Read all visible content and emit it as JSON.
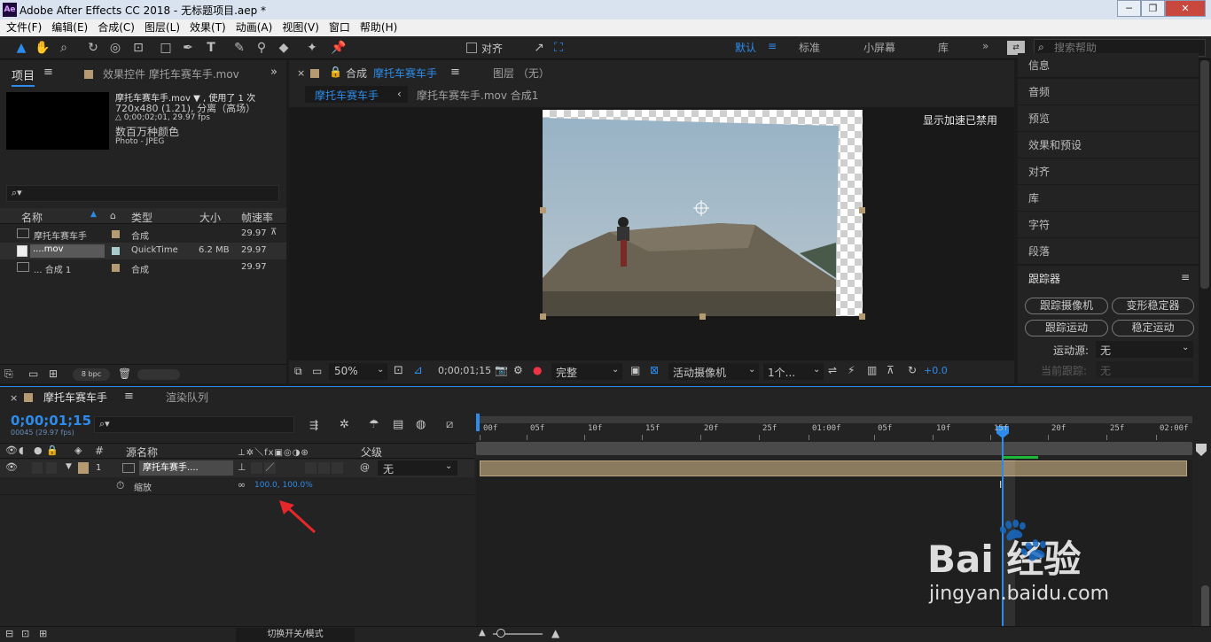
{
  "titlebar": {
    "app_icon": "Ae",
    "title": "Adobe After Effects CC 2018 - 无标题项目.aep *",
    "minimize": "─",
    "restore": "❐",
    "close": "✕"
  },
  "menu": [
    "文件(F)",
    "编辑(E)",
    "合成(C)",
    "图层(L)",
    "效果(T)",
    "动画(A)",
    "视图(V)",
    "窗口",
    "帮助(H)"
  ],
  "toolbar": {
    "snap_label": "对齐",
    "workspaces": [
      "默认",
      "标准",
      "小屏幕",
      "库"
    ],
    "search_placeholder": "搜索帮助"
  },
  "project": {
    "tab": "项目",
    "effects_tab": "效果控件 摩托车赛车手.mov",
    "selected_name": "摩托车赛车手.mov ▼ , 使用了 1 次",
    "info1": "720x480 (1.21), 分离（高场）",
    "info2": "△ 0;00;02;01, 29.97 fps",
    "info3": "数百万种颜色",
    "info4": "Photo - JPEG",
    "columns": [
      "名称",
      "类型",
      "大小",
      "帧速率"
    ],
    "rows": [
      {
        "name": "摩托车赛车手",
        "type": "合成",
        "size": "",
        "fps": "29.97",
        "color": "#b59a72"
      },
      {
        "name": "....mov",
        "type": "QuickTime",
        "size": "6.2 MB",
        "fps": "29.97",
        "color": "#a8cbcc"
      },
      {
        "name": "... 合成 1",
        "type": "合成",
        "size": "",
        "fps": "29.97",
        "color": "#b59a72"
      }
    ],
    "bpc": "8 bpc"
  },
  "viewer": {
    "comp_tab_prefix": "合成",
    "comp_name": "摩托车赛车手",
    "layer_tab": "图层 （无）",
    "nav_comp": "摩托车赛车手",
    "nav_path": "摩托车赛车手.mov 合成1",
    "accel_msg": "显示加速已禁用",
    "zoom": "50%",
    "timecode": "0;00;01;15",
    "quality": "完整",
    "camera": "活动摄像机",
    "views": "1个...",
    "exposure": "+0.0"
  },
  "right_panel": {
    "items": [
      "信息",
      "音频",
      "预览",
      "效果和预设",
      "对齐",
      "库",
      "字符",
      "段落"
    ],
    "tracker": {
      "title": "跟踪器",
      "buttons": [
        "跟踪摄像机",
        "变形稳定器",
        "跟踪运动",
        "稳定运动"
      ],
      "source_label": "运动源:",
      "source_value": "无",
      "current_label": "当前跟踪:",
      "current_value": "无"
    }
  },
  "timeline": {
    "tab": "摩托车赛车手",
    "render_tab": "渲染队列",
    "timecode": "0;00;01;15",
    "frames": "00045 (29.97 fps)",
    "col_headers": {
      "num": "#",
      "source": "源名称",
      "parent": "父级"
    },
    "layer": {
      "num": "1",
      "name": "摩托车赛手....",
      "parent": "无",
      "label_color": "#b59a72"
    },
    "property": {
      "name": "缩放",
      "value": "100.0, 100.0%"
    },
    "ruler": [
      "00f",
      "05f",
      "10f",
      "15f",
      "20f",
      "25f",
      "01:00f",
      "05f",
      "10f",
      "15f",
      "20f",
      "25f",
      "02:00f"
    ],
    "toggle_label": "切换开关/模式"
  },
  "colors": {
    "accent": "#2d8ceb",
    "bar": "#8a7a5e",
    "arrow": "#e8272b"
  },
  "watermark": {
    "brand": "Bai  经验",
    "url": "jingyan.baidu.com"
  }
}
